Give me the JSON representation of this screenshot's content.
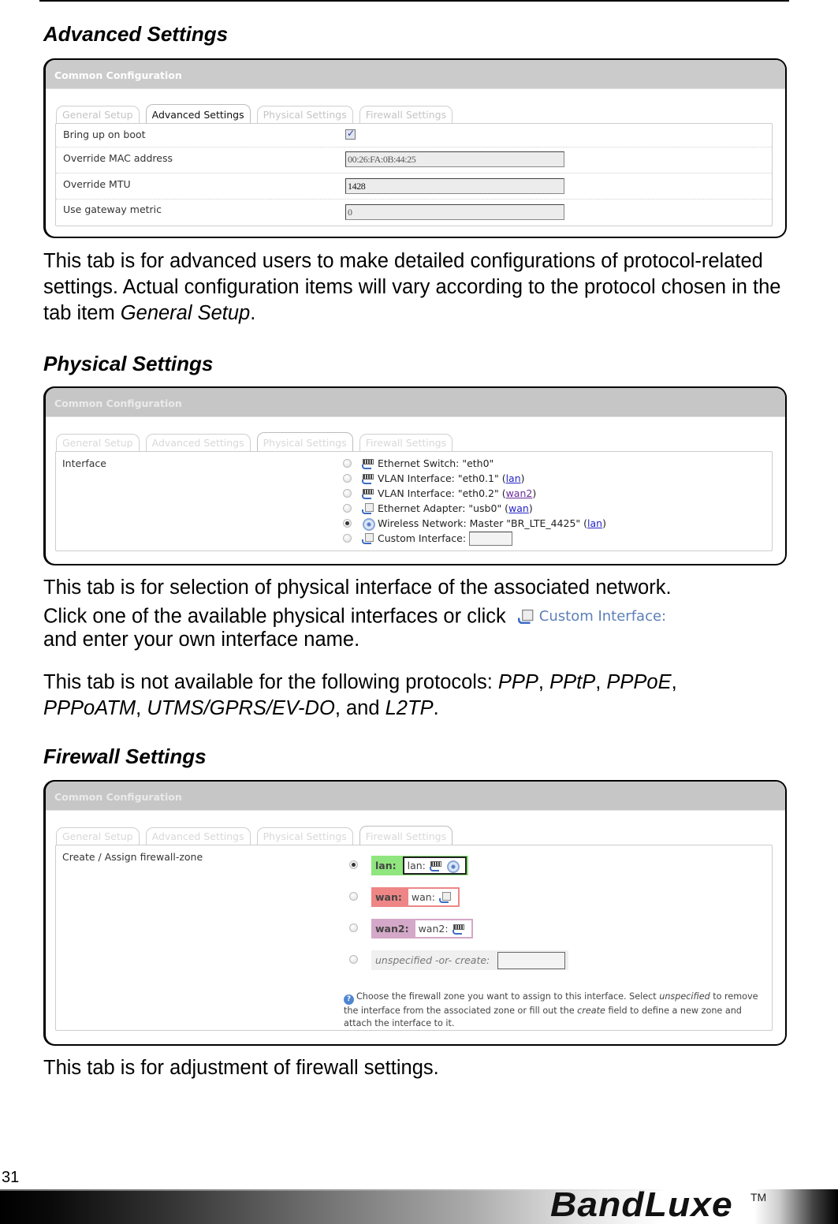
{
  "page": {
    "page_number": "31",
    "brand": "BandLuxe",
    "trademark": "TM"
  },
  "panel": {
    "title": "Common Configuration",
    "tabs": [
      "General Setup",
      "Advanced Settings",
      "Physical Settings",
      "Firewall Settings"
    ]
  },
  "advanced": {
    "heading": "Advanced Settings",
    "active_tab": "Advanced Settings",
    "rows": [
      {
        "label": "Bring up on boot",
        "type": "checkbox",
        "checked": true
      },
      {
        "label": "Override MAC address",
        "type": "text",
        "value": "00:26:FA:0B:44:25"
      },
      {
        "label": "Override MTU",
        "type": "text",
        "value": "1428"
      },
      {
        "label": "Use gateway metric",
        "type": "text",
        "value": "0"
      }
    ],
    "description_1": "This tab is for advanced users to make detailed configurations of protocol-related settings. Actual configuration items will vary according to the protocol chosen in the tab item ",
    "description_italic": "General Setup",
    "description_end": "."
  },
  "physical": {
    "heading": "Physical Settings",
    "active_tab": "Physical Settings",
    "field_label": "Interface",
    "interfaces": [
      {
        "icon": "ethernet-switch-icon",
        "text": "Ethernet Switch: \"eth0\"",
        "link": "",
        "selected": false
      },
      {
        "icon": "ethernet-switch-icon",
        "text": "VLAN Interface: \"eth0.1\" (",
        "link": "lan",
        "after": ")",
        "selected": false
      },
      {
        "icon": "ethernet-switch-icon",
        "text": "VLAN Interface: \"eth0.2\" (",
        "link": "wan2",
        "after": ")",
        "selected": false
      },
      {
        "icon": "ethernet-adapter-icon",
        "text": "Ethernet Adapter: \"usb0\" (",
        "link": "wan",
        "after": ")",
        "selected": false
      },
      {
        "icon": "wireless-icon",
        "text": "Wireless Network: Master \"BR_LTE_4425\" (",
        "link": "lan",
        "after": ")",
        "selected": true
      },
      {
        "icon": "ethernet-adapter-icon",
        "text": "Custom Interface:",
        "link": "",
        "selected": false,
        "custom_value": ""
      }
    ],
    "description_1": "This tab is for selection of physical interface of the associated network.",
    "description_2a": "Click one of the available physical interfaces or click",
    "description_2_inline": "Custom Interface:",
    "description_2b": "and enter your own interface name.",
    "description_3a": "This tab is not available for the following protocols: ",
    "protocols": [
      "PPP",
      "PPtP",
      "PPPoE",
      "PPPoATM",
      "UTMS/GPRS/EV-DO",
      "L2TP"
    ]
  },
  "firewall": {
    "heading": "Firewall Settings",
    "active_tab": "Firewall Settings",
    "field_label": "Create / Assign firewall-zone",
    "zones": [
      {
        "name": "lan:",
        "box_label": "lan:",
        "color": "#90e67e",
        "selected": true
      },
      {
        "name": "wan:",
        "box_label": "wan:",
        "color": "#ee8686",
        "selected": false
      },
      {
        "name": "wan2:",
        "box_label": "wan2:",
        "color": "#d4a8c8",
        "selected": false
      }
    ],
    "unspecified_label": "unspecified -or- create:",
    "create_value": "",
    "help_1": "Choose the firewall zone you want to assign to this interface. Select ",
    "help_unspecified": "unspecified",
    "help_2": " to remove the interface from the associated zone or fill out the ",
    "help_create": "create",
    "help_3": " field to define a new zone and attach the interface to it.",
    "description": "This tab is for adjustment of firewall settings."
  }
}
